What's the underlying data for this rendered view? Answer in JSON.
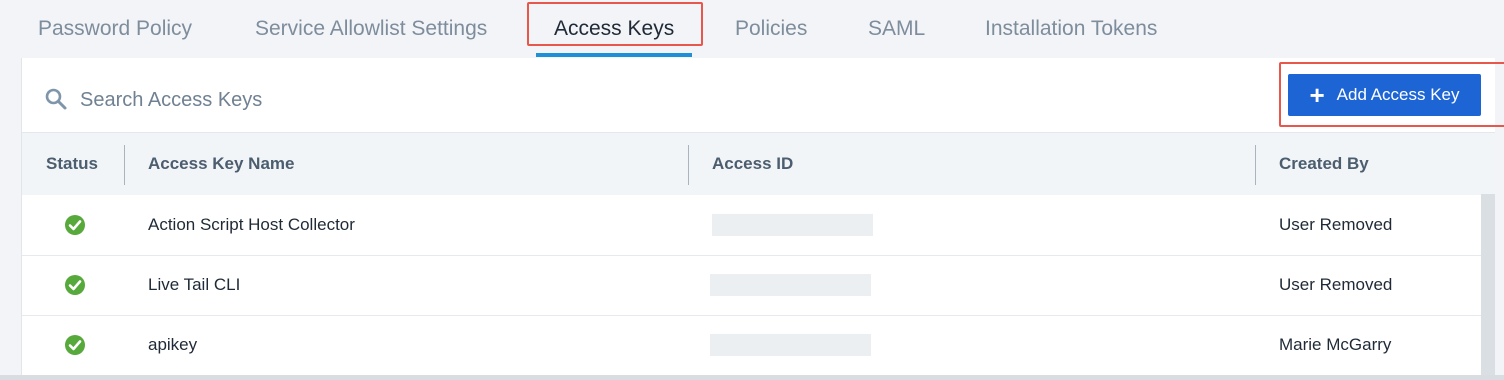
{
  "tabs": [
    {
      "label": "Password Policy",
      "active": false
    },
    {
      "label": "Service Allowlist Settings",
      "active": false
    },
    {
      "label": "Access Keys",
      "active": true
    },
    {
      "label": "Policies",
      "active": false
    },
    {
      "label": "SAML",
      "active": false
    },
    {
      "label": "Installation Tokens",
      "active": false
    }
  ],
  "search": {
    "placeholder": "Search Access Keys",
    "value": ""
  },
  "add_button": {
    "label": "Add Access Key",
    "icon": "plus-icon"
  },
  "table": {
    "columns": [
      "Status",
      "Access Key Name",
      "Access ID",
      "Created By"
    ],
    "rows": [
      {
        "status": "active",
        "name": "Action Script Host Collector",
        "access_id": "",
        "created_by": "User Removed"
      },
      {
        "status": "active",
        "name": "Live Tail CLI",
        "access_id": "",
        "created_by": "User Removed"
      },
      {
        "status": "active",
        "name": "apikey",
        "access_id": "",
        "created_by": "Marie McGarry"
      }
    ]
  },
  "colors": {
    "accent": "#1f8fd8",
    "button": "#1d64d4",
    "highlight": "#e8574b",
    "status_ok": "#56a93a"
  }
}
